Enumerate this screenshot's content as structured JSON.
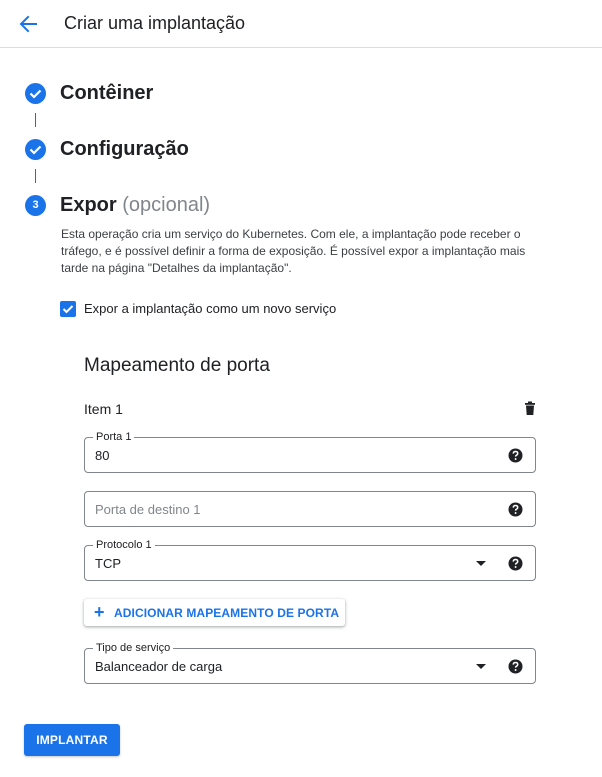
{
  "header": {
    "title": "Criar uma implantação",
    "back_icon": "arrow-back-icon"
  },
  "steps": [
    {
      "title": "Contêiner",
      "status": "complete",
      "icon": "check-circle-icon"
    },
    {
      "title": "Configuração",
      "status": "complete",
      "icon": "check-circle-icon"
    },
    {
      "number": "3",
      "title": "Expor",
      "optional_label": "(opcional)",
      "status": "current"
    }
  ],
  "description": "Esta operação cria um serviço do Kubernetes. Com ele, a implantação pode receber o tráfego, e é possível definir a forma de exposição. É possível expor a implantação mais tarde na página \"Detalhes da implantação\".",
  "expose_checkbox": {
    "label": "Expor a implantação como um novo serviço",
    "checked": true
  },
  "port_mapping": {
    "title": "Mapeamento de porta",
    "item_title": "Item 1",
    "port": {
      "label": "Porta 1",
      "value": "80"
    },
    "target_port": {
      "placeholder": "Porta de destino 1",
      "value": ""
    },
    "protocol": {
      "label": "Protocolo 1",
      "value": "TCP"
    },
    "add_button": "ADICIONAR MAPEAMENTO DE PORTA"
  },
  "service_type": {
    "label": "Tipo de serviço",
    "value": "Balanceador de carga"
  },
  "submit_button": "IMPLANTAR",
  "colors": {
    "accent": "#1a73e8",
    "text": "#202124",
    "border": "#80868b",
    "muted": "#80868b"
  }
}
